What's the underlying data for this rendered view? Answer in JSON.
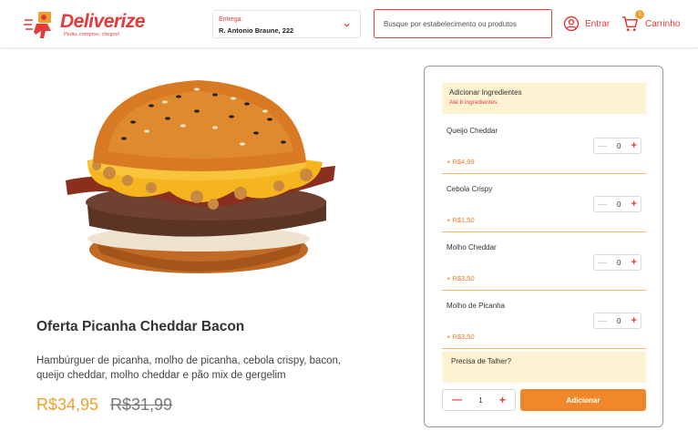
{
  "brand": {
    "name": "Deliverize",
    "tagline": "Pediu, comprou, chegou!",
    "color": "#e23b3b",
    "accent": "#f0872b"
  },
  "header": {
    "address_label": "Entrega:",
    "address_value": "R. Antonio Braune, 222",
    "search_placeholder": "Busque por estabelecimento ou produtos",
    "login_label": "Entrar",
    "cart_label": "Carrinho",
    "cart_count": "1"
  },
  "product": {
    "title": "Oferta Picanha Cheddar Bacon",
    "description": "Hambúrguer de picanha, molho de picanha, cebola crispy, bacon, queijo cheddar, molho cheddar e pão mix de gergelim",
    "price": "R$34,95",
    "old_price": "R$31,99"
  },
  "ingredients": {
    "title": "Adicionar Ingredientes",
    "subtitle": "Até 8 ingredientes.",
    "items": [
      {
        "name": "Queijo Cheddar",
        "price": "+ R$4,99",
        "qty": "0"
      },
      {
        "name": "Cebola Crispy",
        "price": "+ R$1,50",
        "qty": "0"
      },
      {
        "name": "Molho Cheddar",
        "price": "+ R$3,50",
        "qty": "0"
      },
      {
        "name": "Molho de Picanha",
        "price": "+ R$3,50",
        "qty": "0"
      }
    ]
  },
  "cutlery": {
    "title": "Precisa de Talher?"
  },
  "order": {
    "qty": "1",
    "add_label": "Adicionar"
  }
}
